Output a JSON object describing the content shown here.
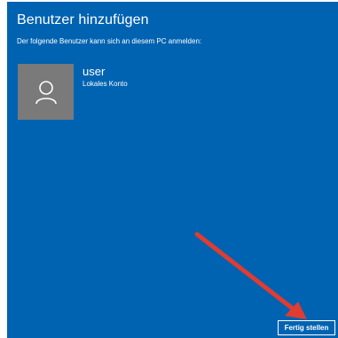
{
  "dialog": {
    "title": "Benutzer hinzufügen",
    "subtitle": "Der folgende Benutzer kann sich an diesem PC anmelden:"
  },
  "user": {
    "name": "user",
    "account_type": "Lokales Konto",
    "avatar_icon": "user-silhouette-icon"
  },
  "actions": {
    "finish_label": "Fertig stellen"
  },
  "annotation": {
    "arrow_icon": "red-arrow-icon",
    "arrow_color": "#e03c31"
  },
  "colors": {
    "background": "#0063b1",
    "avatar_background": "#7a7a7a",
    "text": "#ffffff"
  }
}
